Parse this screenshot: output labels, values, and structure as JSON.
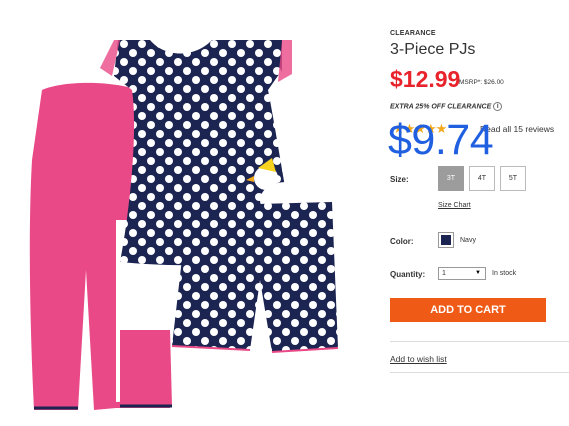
{
  "product": {
    "clearance_tag": "CLEARANCE",
    "title": "3-Piece PJs",
    "price": "$12.99",
    "msrp": "MSRP*: $26.00",
    "extra_offer": "EXTRA 25% OFF CLEARANCE",
    "info_icon_glyph": "i",
    "sale_price_overlay": "$9.74"
  },
  "rating": {
    "stars_glyphs": "★★★★★",
    "stars": 4.5,
    "reviews_link": "Read all 15 reviews"
  },
  "size": {
    "label": "Size:",
    "options": [
      "3T",
      "4T",
      "5T"
    ],
    "selected": "3T",
    "chart_link": "Size Chart"
  },
  "color": {
    "label": "Color:",
    "name": "Navy",
    "swatch": "#1c2452"
  },
  "quantity": {
    "label": "Quantity:",
    "value": "1",
    "caret": "▼",
    "stock": "In stock"
  },
  "actions": {
    "add_to_cart": "ADD TO CART",
    "add_to_wishlist": "Add to wish list"
  },
  "colors": {
    "price_red": "#e8232b",
    "cta_orange": "#f05a17",
    "overlay_blue": "#1f5fe0",
    "pants_pink": "#e94a87",
    "top_navy": "#1c2452"
  }
}
